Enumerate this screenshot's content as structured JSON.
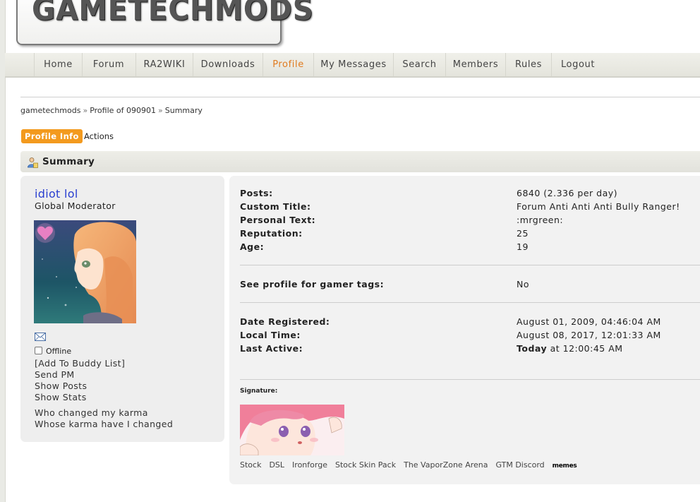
{
  "site": {
    "logo_text": "GAMETECHMODS"
  },
  "nav": [
    {
      "label": "Home",
      "active": false
    },
    {
      "label": "Forum",
      "active": false
    },
    {
      "label": "RA2WIKI",
      "active": false
    },
    {
      "label": "Downloads",
      "active": false
    },
    {
      "label": "Profile",
      "active": true
    },
    {
      "label": "My Messages",
      "active": false
    },
    {
      "label": "Search",
      "active": false
    },
    {
      "label": "Members",
      "active": false
    },
    {
      "label": "Rules",
      "active": false
    },
    {
      "label": "Logout",
      "active": false
    }
  ],
  "breadcrumb": [
    "gametechmods",
    "Profile of 090901",
    "Summary"
  ],
  "breadcrumb_sep": "»",
  "tabs": {
    "active": "Profile Info",
    "other": "Actions"
  },
  "summary": {
    "title": "Summary",
    "icon": "user-profile-icon"
  },
  "user": {
    "name": "idiot lol",
    "group": "Global Moderator",
    "status": "Offline",
    "links": [
      "[Add To Buddy List]",
      "Send PM",
      "Show Posts",
      "Show Stats"
    ],
    "karma_links": [
      "Who changed my karma",
      "Whose karma have I changed"
    ]
  },
  "stats": {
    "group1": [
      {
        "label": "Posts:",
        "value": "6840 (2.336 per day)"
      },
      {
        "label": "Custom Title:",
        "value": "Forum Anti Anti Anti Bully Ranger!"
      },
      {
        "label": "Personal Text:",
        "value": ":mrgreen:"
      },
      {
        "label": "Reputation:",
        "value": "25"
      },
      {
        "label": "Age:",
        "value": "19"
      }
    ],
    "group2": [
      {
        "label": "See profile for gamer tags:",
        "value": "No"
      }
    ],
    "group3": [
      {
        "label": "Date Registered:",
        "value": "August 01, 2009, 04:46:04 AM"
      },
      {
        "label": "Local Time:",
        "value": "August 08, 2017, 12:01:33 AM"
      },
      {
        "label": "Last Active:",
        "value_bold": "Today",
        "value": " at 12:00:45 AM"
      }
    ]
  },
  "signature": {
    "label": "Signature:",
    "links": [
      "Stock",
      "DSL",
      "Ironforge",
      "Stock Skin Pack",
      "The VaporZone Arena",
      "GTM Discord"
    ],
    "memes": "memes"
  },
  "colors": {
    "accent": "#e07b20",
    "tab_active": "#f39a1e",
    "username": "#2a3fd0"
  }
}
